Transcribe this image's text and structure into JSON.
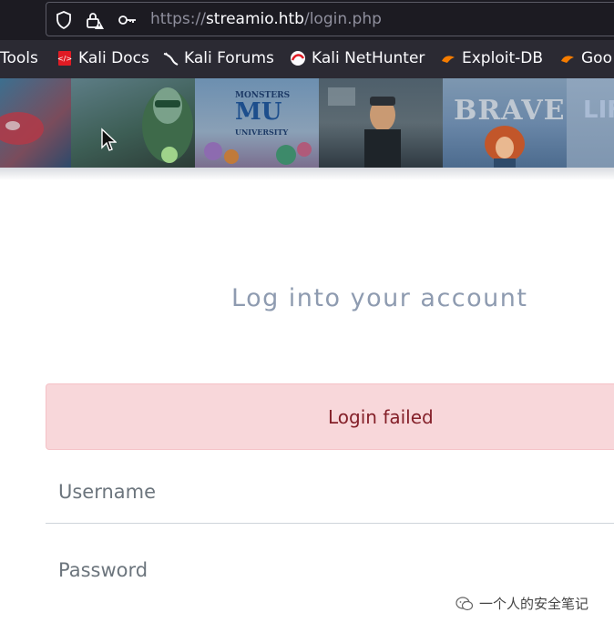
{
  "browser": {
    "url_scheme": "https://",
    "url_host": "streamio.htb",
    "url_path": "/login.php"
  },
  "bookmarks": [
    {
      "label": "Tools",
      "icon": "none"
    },
    {
      "label": "Kali Docs",
      "icon": "kali-docs-icon"
    },
    {
      "label": "Kali Forums",
      "icon": "kali-forums-icon"
    },
    {
      "label": "Kali NetHunter",
      "icon": "kali-nethunter-icon"
    },
    {
      "label": "Exploit-DB",
      "icon": "exploit-db-icon"
    },
    {
      "label": "Goo",
      "icon": "google-icon"
    }
  ],
  "banner": {
    "posters": [
      "Monsters University",
      "Green Lantern",
      "Cars",
      "Brave",
      "LIF"
    ],
    "texts": {
      "monsters": "MONSTERS",
      "mu": "MU",
      "university": "UNIVERSITY",
      "brave": "BRAVE",
      "lif": "LIF"
    }
  },
  "login": {
    "title": "Log into your account",
    "error": "Login failed",
    "username_placeholder": "Username",
    "password_placeholder": "Password"
  },
  "watermark": {
    "text": "一个人的安全笔记"
  },
  "colors": {
    "alert_bg": "#f8d7da",
    "alert_text": "#842029",
    "title": "#8e9bb0"
  }
}
